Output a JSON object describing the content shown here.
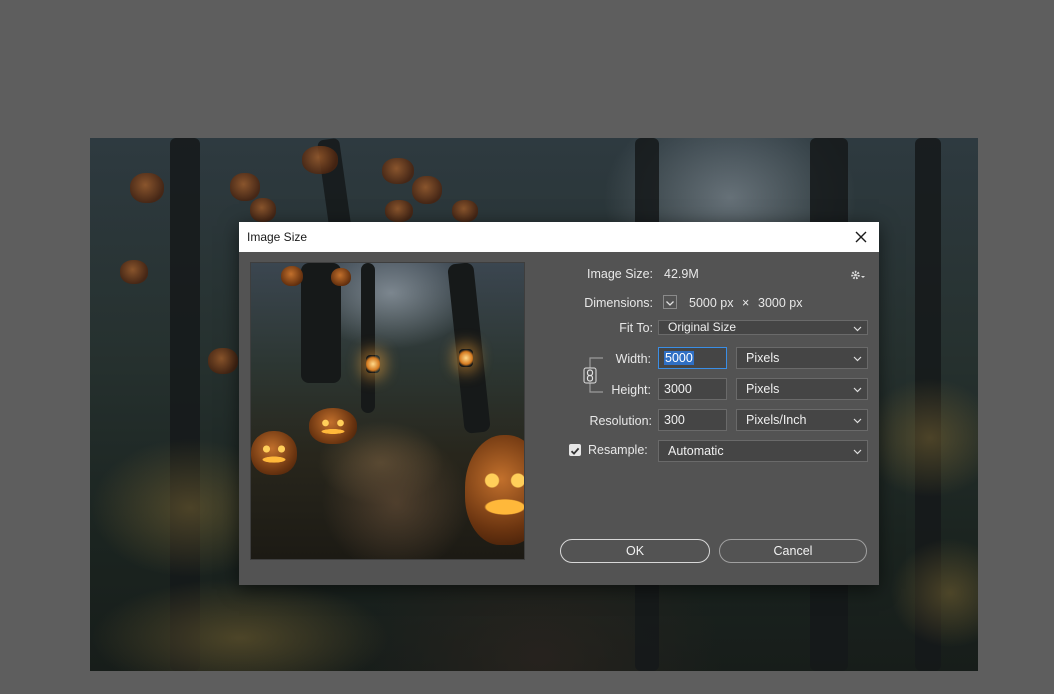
{
  "dialog": {
    "title": "Image Size"
  },
  "info": {
    "image_size_label": "Image Size:",
    "image_size_value": "42.9M",
    "dimensions_label": "Dimensions:",
    "dim_width": "5000 px",
    "dim_times": "×",
    "dim_height": "3000 px"
  },
  "fit_to": {
    "label": "Fit To:",
    "value": "Original Size"
  },
  "width": {
    "label": "Width:",
    "value": "5000",
    "unit": "Pixels"
  },
  "height": {
    "label": "Height:",
    "value": "3000",
    "unit": "Pixels"
  },
  "resolution": {
    "label": "Resolution:",
    "value": "300",
    "unit": "Pixels/Inch"
  },
  "resample": {
    "label": "Resample:",
    "checked": true,
    "value": "Automatic"
  },
  "buttons": {
    "ok": "OK",
    "cancel": "Cancel"
  },
  "icons": {
    "close": "close-icon",
    "gear": "gear-icon",
    "chevron": "chevron-down-icon",
    "link": "chain-link-icon",
    "check": "checkmark-icon"
  },
  "colors": {
    "dialog_bg": "#535353",
    "focus_accent": "#3a8ee6",
    "selection": "#2f6fc4"
  }
}
